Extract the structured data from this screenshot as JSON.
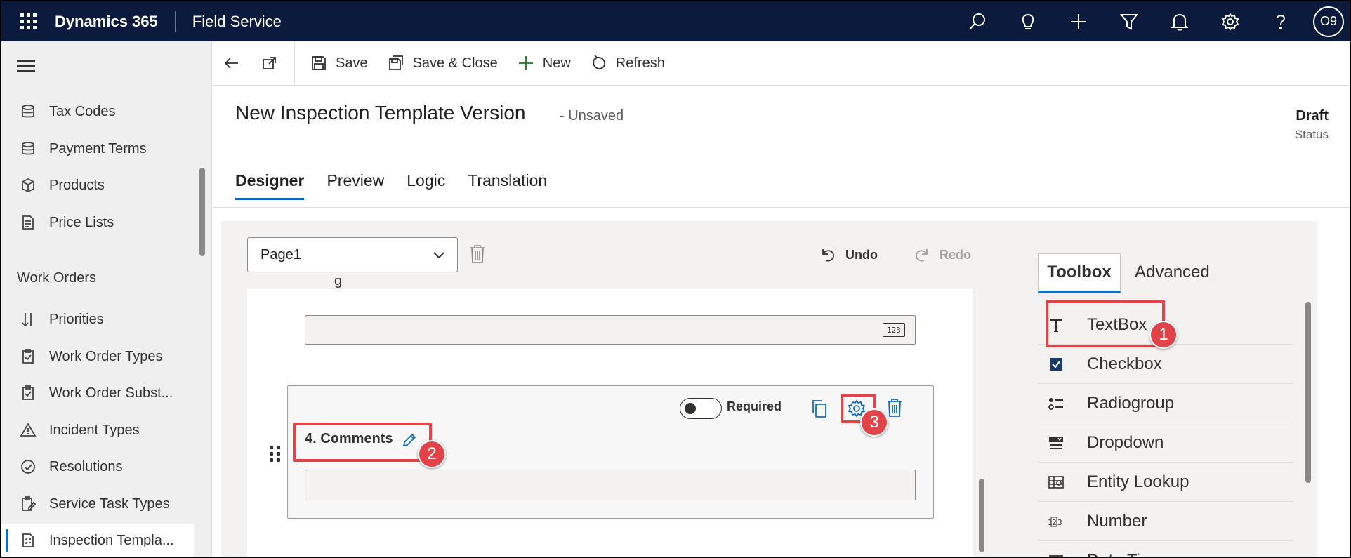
{
  "topbar": {
    "brand": "Dynamics 365",
    "module": "Field Service",
    "icons": [
      "search-icon",
      "lightbulb-icon",
      "plus-icon",
      "filter-icon",
      "bell-icon",
      "gear-icon",
      "help-icon"
    ],
    "avatar_initials": "O9"
  },
  "sidebar": {
    "items_top": [
      {
        "label": "Tax Codes",
        "icon": "database-icon"
      },
      {
        "label": "Payment Terms",
        "icon": "database-icon"
      },
      {
        "label": "Products",
        "icon": "cube-icon"
      },
      {
        "label": "Price Lists",
        "icon": "document-icon"
      }
    ],
    "section_title": "Work Orders",
    "items_work_orders": [
      {
        "label": "Priorities",
        "icon": "sort-icon"
      },
      {
        "label": "Work Order Types",
        "icon": "clipboard-icon"
      },
      {
        "label": "Work Order Subst...",
        "icon": "clipboard-icon"
      },
      {
        "label": "Incident Types",
        "icon": "warning-icon"
      },
      {
        "label": "Resolutions",
        "icon": "check-circle-icon"
      },
      {
        "label": "Service Task Types",
        "icon": "clipboard-edit-icon"
      },
      {
        "label": "Inspection Templa...",
        "icon": "checklist-icon",
        "active": true
      }
    ]
  },
  "commandbar": {
    "save": "Save",
    "save_close": "Save & Close",
    "new": "New",
    "refresh": "Refresh"
  },
  "form": {
    "title": "New Inspection Template Version",
    "unsaved": "- Unsaved",
    "status_value": "Draft",
    "status_label": "Status"
  },
  "tabs": [
    {
      "label": "Designer",
      "active": true
    },
    {
      "label": "Preview"
    },
    {
      "label": "Logic"
    },
    {
      "label": "Translation"
    }
  ],
  "designer": {
    "page_select_value": "Page1",
    "undo": "Undo",
    "redo": "Redo",
    "number_icon_text": "123",
    "question": {
      "title": "4. Comments",
      "required_label": "Required",
      "required_on": false
    }
  },
  "panel": {
    "tab_toolbox": "Toolbox",
    "tab_advanced": "Advanced",
    "tools": [
      {
        "label": "TextBox",
        "icon": "text-icon"
      },
      {
        "label": "Checkbox",
        "icon": "checkbox-icon"
      },
      {
        "label": "Radiogroup",
        "icon": "radiogroup-icon"
      },
      {
        "label": "Dropdown",
        "icon": "dropdown-icon"
      },
      {
        "label": "Entity Lookup",
        "icon": "lookup-icon"
      },
      {
        "label": "Number",
        "icon": "number-icon"
      },
      {
        "label": "Date Time",
        "icon": "calendar-icon"
      }
    ]
  },
  "callouts": [
    "1",
    "2",
    "3"
  ],
  "colors": {
    "topbar": "#0b1a3d",
    "accent": "#0f6cbd",
    "callout": "#e04448"
  }
}
